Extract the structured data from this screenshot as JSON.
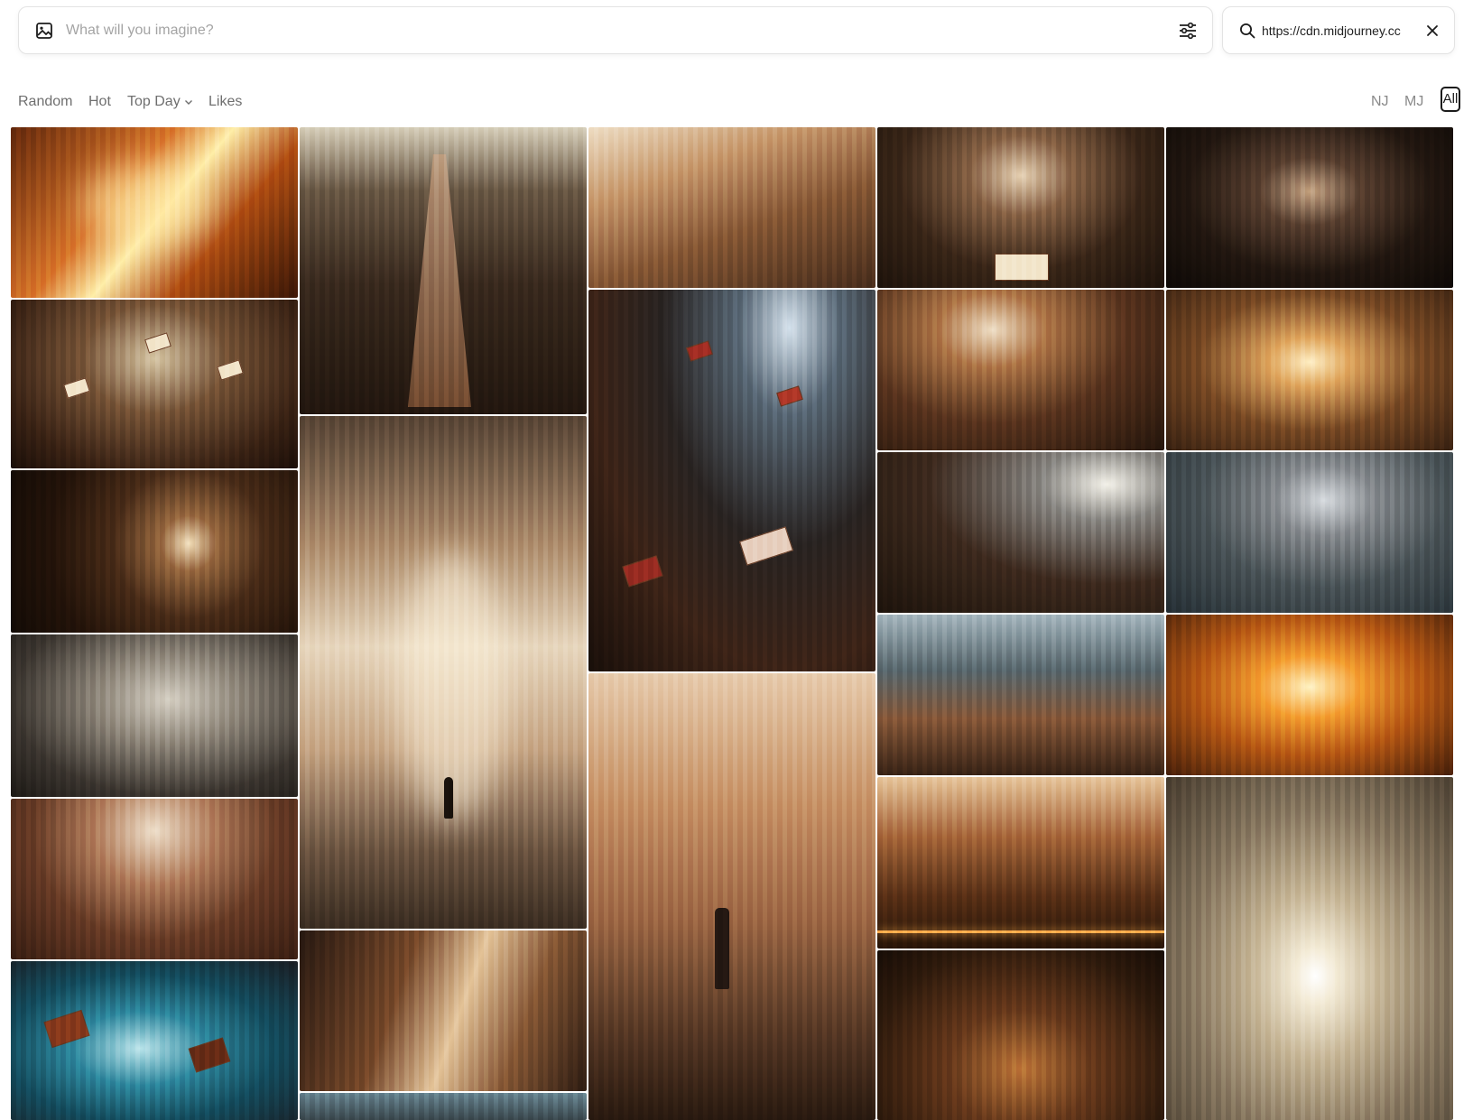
{
  "prompt": {
    "placeholder": "What will you imagine?",
    "value": ""
  },
  "url_search": {
    "value": "https://cdn.midjourney.cc"
  },
  "sort_filters": [
    {
      "label": "Random"
    },
    {
      "label": "Hot"
    },
    {
      "label": "Top Day"
    },
    {
      "label": "Likes"
    }
  ],
  "source_filters": [
    {
      "label": "NJ"
    },
    {
      "label": "MJ"
    },
    {
      "label": "All",
      "selected": true
    }
  ],
  "icons": {
    "prompt": "image-icon",
    "settings": "sliders-icon",
    "search": "search-icon",
    "clear": "close-icon",
    "dropdown": "chevron-down-icon"
  },
  "colors": {
    "accent": "#1b1b1b",
    "muted_text": "#6f6f6f",
    "border": "#e3e3e3"
  }
}
